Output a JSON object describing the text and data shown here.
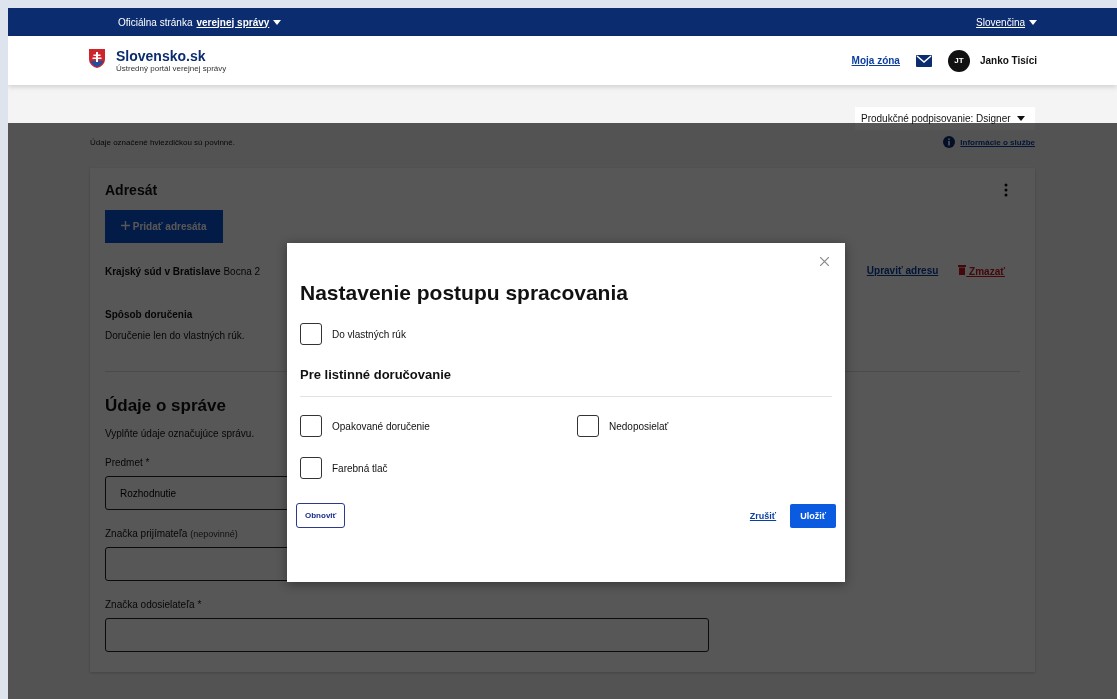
{
  "top_bar": {
    "official_text": "Oficiálna stránka",
    "official_link": "verejnej správy",
    "language": "Slovenčina"
  },
  "header": {
    "logo_title": "Slovensko.sk",
    "logo_subtitle": "Ústredný portál verejnej správy",
    "my_zone": "Moja zóna",
    "avatar_initials": "JT",
    "user_name": "Janko Tisíci"
  },
  "signing_select": {
    "value": "Produkčné podpisovanie: Dsigner"
  },
  "required_note": "Údaje označené hviezdičkou sú povinné.",
  "service_info_link": "Informácie o službe",
  "recipient_card": {
    "title": "Adresát",
    "add_button": "Pridať adresáta",
    "recipient_name": "Krajský súd v Bratislave",
    "recipient_address": "Bocna 2",
    "edit_link": "Upraviť adresu",
    "delete_link": "Zmazať",
    "delivery_label": "Spôsob doručenia",
    "delivery_value": "Doručenie len do vlastných rúk."
  },
  "message_section": {
    "title": "Údaje o správe",
    "description": "Vyplňte údaje označujúce správu.",
    "fields": [
      {
        "label": "Predmet *",
        "value": "Rozhodnutie"
      },
      {
        "label": "Značka prijímateľa",
        "hint": "(nepovinné)"
      },
      {
        "label": "Značka odosielateľa *"
      }
    ]
  },
  "modal": {
    "title": "Nastavenie postupu spracovania",
    "options": [
      {
        "label": "Do vlastných rúk",
        "checked": false
      }
    ],
    "section_title": "Pre listinné doručovanie",
    "paper_options": [
      {
        "label": "Opakované doručenie",
        "checked": false
      },
      {
        "label": "Nedoposielať",
        "checked": false
      },
      {
        "label": "Farebná tlač",
        "checked": false
      }
    ],
    "reset_button": "Obnoviť",
    "cancel_link": "Zrušiť",
    "save_button": "Uložiť"
  }
}
